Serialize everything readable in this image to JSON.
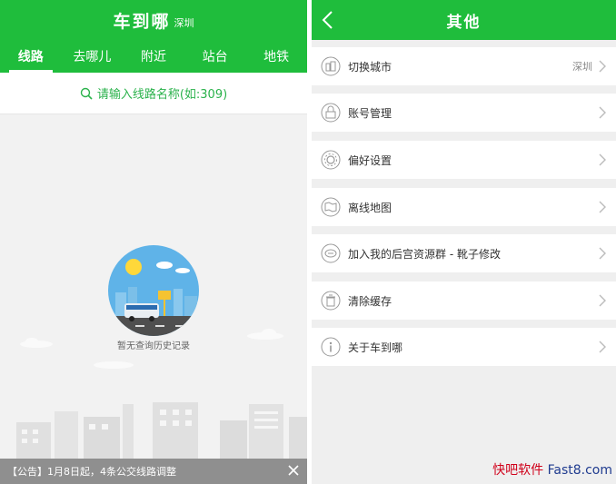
{
  "left": {
    "header": {
      "title": "车到哪",
      "city": "深圳"
    },
    "tabs": [
      {
        "label": "线路",
        "active": true
      },
      {
        "label": "去哪儿",
        "active": false
      },
      {
        "label": "附近",
        "active": false
      },
      {
        "label": "站台",
        "active": false
      },
      {
        "label": "地铁",
        "active": false
      }
    ],
    "search": {
      "placeholder": "请输入线路名称(如:309)"
    },
    "history": {
      "empty_text": "暂无查询历史记录"
    },
    "notice": {
      "text": "【公告】1月8日起，4条公交线路调整"
    }
  },
  "right": {
    "header": {
      "title": "其他"
    },
    "menu": [
      {
        "label": "切换城市",
        "value": "深圳",
        "icon": "building-icon"
      },
      {
        "label": "账号管理",
        "value": "",
        "icon": "lock-icon"
      },
      {
        "label": "偏好设置",
        "value": "",
        "icon": "gear-icon"
      },
      {
        "label": "离线地图",
        "value": "",
        "icon": "map-icon"
      },
      {
        "label": "加入我的后宫资源群 - 靴子修改",
        "value": "",
        "icon": "chat-icon"
      },
      {
        "label": "清除缓存",
        "value": "",
        "icon": "trash-icon"
      },
      {
        "label": "关于车到哪",
        "value": "",
        "icon": "info-icon"
      }
    ]
  },
  "watermark": {
    "part1": "快吧软件",
    "part2": "Fast8.com"
  },
  "colors": {
    "brand_green": "#1fbd3c",
    "link_green": "#2ab24b",
    "notice_gray": "#8f8f8f"
  }
}
